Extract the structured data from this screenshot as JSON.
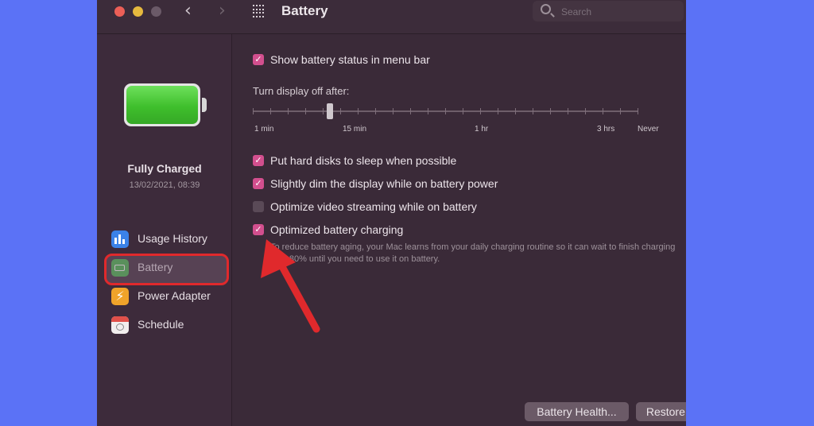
{
  "window": {
    "title": "Battery",
    "nav_back_icon": "chevron-left",
    "nav_forward_icon": "chevron-right",
    "search_placeholder": "Search"
  },
  "sidebar": {
    "status": "Fully Charged",
    "timestamp": "13/02/2021, 08:39",
    "items": [
      {
        "label": "Usage History",
        "icon": "usage-history-icon",
        "color": "#3b82e8"
      },
      {
        "label": "Battery",
        "icon": "battery-icon",
        "color": "#42b84a",
        "selected": true
      },
      {
        "label": "Power Adapter",
        "icon": "power-adapter-icon",
        "color": "#f0a32a",
        "glyph": "⚡"
      },
      {
        "label": "Schedule",
        "icon": "schedule-icon",
        "color": "#f2eeee"
      }
    ]
  },
  "options": {
    "show_status": {
      "label": "Show battery status in menu bar",
      "checked": true
    },
    "display_off": {
      "label": "Turn display off after:",
      "ticks": [
        "1 min",
        "15 min",
        "1 hr",
        "3 hrs",
        "Never"
      ],
      "value": "15 min"
    },
    "hard_disks": {
      "label": "Put hard disks to sleep when possible",
      "checked": true
    },
    "dim_display": {
      "label": "Slightly dim the display while on battery power",
      "checked": true
    },
    "video_streaming": {
      "label": "Optimize video streaming while on battery",
      "checked": false
    },
    "optimized_charging": {
      "label": "Optimized battery charging",
      "checked": true,
      "description": "To reduce battery aging, your Mac learns from your daily charging routine so it can wait to finish charging past 80% until you need to use it on battery."
    }
  },
  "buttons": {
    "battery_health": "Battery Health...",
    "restore_defaults": "Restore Defaults",
    "help": "?"
  },
  "colors": {
    "accent": "#d24f8e",
    "highlight": "#e0292c",
    "background": "#5b72f6"
  }
}
